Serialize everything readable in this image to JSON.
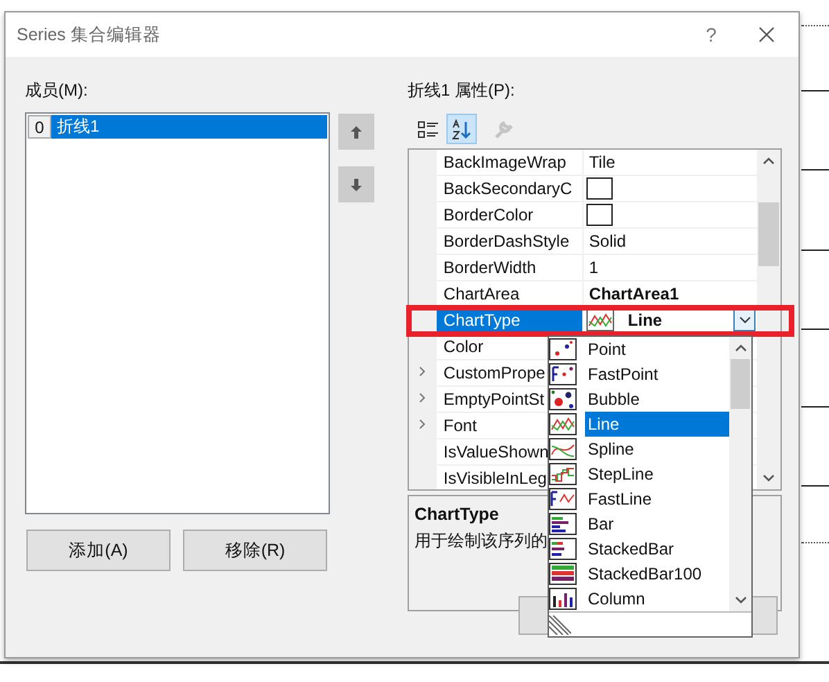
{
  "window": {
    "title": "Series 集合编辑器",
    "help": "?"
  },
  "members": {
    "label": "成员(M):",
    "items": [
      {
        "index": "0",
        "name": "折线1",
        "selected": true
      }
    ]
  },
  "move_buttons": [
    {
      "kind": "up",
      "disabled": false
    },
    {
      "kind": "down",
      "disabled": false
    }
  ],
  "member_buttons": [
    "添加(A)",
    "移除(R)"
  ],
  "properties": {
    "label": "折线1 属性(P):",
    "toolbar": [
      {
        "kind": "categorized",
        "selected": false,
        "disabled": false
      },
      {
        "kind": "alphabetical",
        "selected": true,
        "disabled": false
      },
      {
        "kind": "property-pages",
        "selected": false,
        "disabled": true
      }
    ],
    "rows": [
      {
        "name": "BackImageWrap",
        "kind": "text",
        "value": "Tile",
        "expandable": false,
        "selected": false
      },
      {
        "name": "BackSecondaryC",
        "kind": "swatch",
        "expandable": false,
        "selected": false
      },
      {
        "name": "BorderColor",
        "kind": "swatch",
        "expandable": false,
        "selected": false
      },
      {
        "name": "BorderDashStyle",
        "kind": "text",
        "value": "Solid",
        "expandable": false,
        "selected": false
      },
      {
        "name": "BorderWidth",
        "kind": "text",
        "value": "1",
        "expandable": false,
        "selected": false
      },
      {
        "name": "ChartArea",
        "kind": "bold",
        "value": "ChartArea1",
        "expandable": false,
        "selected": false
      },
      {
        "name": "ChartType",
        "kind": "combo",
        "value": "Line",
        "expandable": false,
        "selected": true
      },
      {
        "name": "Color",
        "kind": "hidden",
        "expandable": false,
        "selected": false
      },
      {
        "name": "CustomPrope",
        "kind": "hidden",
        "expandable": true,
        "selected": false
      },
      {
        "name": "EmptyPointSt",
        "kind": "hidden",
        "expandable": true,
        "selected": false
      },
      {
        "name": "Font",
        "kind": "hidden",
        "expandable": true,
        "selected": false
      },
      {
        "name": "IsValueShown",
        "kind": "hidden",
        "expandable": false,
        "selected": false
      },
      {
        "name": "IsVisibleInLeg",
        "kind": "hidden",
        "expandable": false,
        "selected": false
      }
    ],
    "description": {
      "title": "ChartType",
      "text": "用于绘制该序列的"
    }
  },
  "chart_type_list": [
    {
      "label": "Point",
      "selected": false
    },
    {
      "label": "FastPoint",
      "selected": false
    },
    {
      "label": "Bubble",
      "selected": false
    },
    {
      "label": "Line",
      "selected": true
    },
    {
      "label": "Spline",
      "selected": false
    },
    {
      "label": "StepLine",
      "selected": false
    },
    {
      "label": "FastLine",
      "selected": false
    },
    {
      "label": "Bar",
      "selected": false
    },
    {
      "label": "StackedBar",
      "selected": false
    },
    {
      "label": "StackedBar100",
      "selected": false
    },
    {
      "label": "Column",
      "selected": false
    }
  ]
}
